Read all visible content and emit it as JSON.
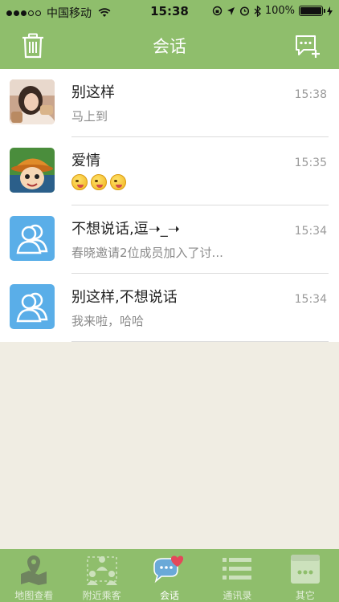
{
  "status_bar": {
    "carrier": "中国移动",
    "time": "15:38",
    "battery": "100%"
  },
  "nav": {
    "title": "会话",
    "left_icon": "trash-icon",
    "right_icon": "new-chat-icon"
  },
  "conversations": [
    {
      "title": "别这样",
      "subtitle": "马上到",
      "time": "15:38",
      "avatar": "photo-avatar"
    },
    {
      "title": "爱情",
      "subtitle": "",
      "time": "15:35",
      "avatar": "cartoon-avatar",
      "emoji_count": 3
    },
    {
      "title": "不想说话,逗➝_➝",
      "subtitle": "春晓邀请2位成员加入了讨...",
      "time": "15:34",
      "avatar": "group-avatar"
    },
    {
      "title": "别这样,不想说话",
      "subtitle": "我来啦，哈哈",
      "time": "15:34",
      "avatar": "group-avatar"
    }
  ],
  "tabs": [
    {
      "label": "地图查看",
      "icon": "map-pin-icon"
    },
    {
      "label": "附近乘客",
      "icon": "people-nearby-icon"
    },
    {
      "label": "会话",
      "icon": "chat-bubbles-icon",
      "active": true
    },
    {
      "label": "通讯录",
      "icon": "list-icon"
    },
    {
      "label": "其它",
      "icon": "more-icon"
    }
  ],
  "colors": {
    "bar_green": "#8fbe6c",
    "background": "#f0ede3",
    "group_avatar_blue": "#5aaee8"
  }
}
